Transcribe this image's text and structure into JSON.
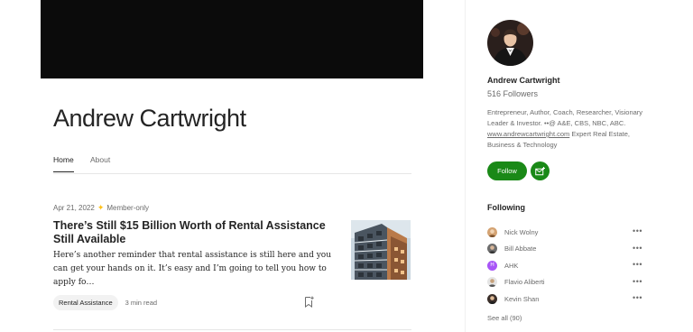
{
  "author": {
    "name": "Andrew Cartwright"
  },
  "tabs": [
    {
      "label": "Home",
      "active": true
    },
    {
      "label": "About",
      "active": false
    }
  ],
  "post": {
    "date": "Apr 21, 2022",
    "member_only": "Member-only",
    "title": "There’s Still $15 Billion Worth of Rental Assistance Still Available",
    "excerpt": "Here’s another reminder that rental assistance is still here and you can get your hands on it. It’s easy and I’m going to tell you how to apply fo…",
    "tag": "Rental Assistance",
    "read_time": "3 min read"
  },
  "sidebar": {
    "name": "Andrew Cartwright",
    "followers": "516 Followers",
    "bio_text": "Entrepreneur, Author, Coach, Researcher, Visionary Leader & Investor. ••@ A&E, CBS, NBC, ABC. ",
    "bio_link": "www.andrewcartwright.com",
    "bio_tail": " Expert Real Estate, Business & Technology",
    "follow_label": "Follow",
    "following_title": "Following",
    "following": [
      {
        "name": "Nick Wolny",
        "avatar": "photo"
      },
      {
        "name": "Bill Abbate",
        "avatar": "photo"
      },
      {
        "name": "AHK",
        "avatar": "initial",
        "initial": "H",
        "color": "#a855f7"
      },
      {
        "name": "Flavio Aliberti",
        "avatar": "photo"
      },
      {
        "name": "Kevin Shan",
        "avatar": "photo"
      }
    ],
    "see_all": "See all (90)"
  },
  "colors": {
    "accent": "#1a8917",
    "star": "#ffc017",
    "text": "#242424",
    "muted": "#6b6b6b"
  }
}
